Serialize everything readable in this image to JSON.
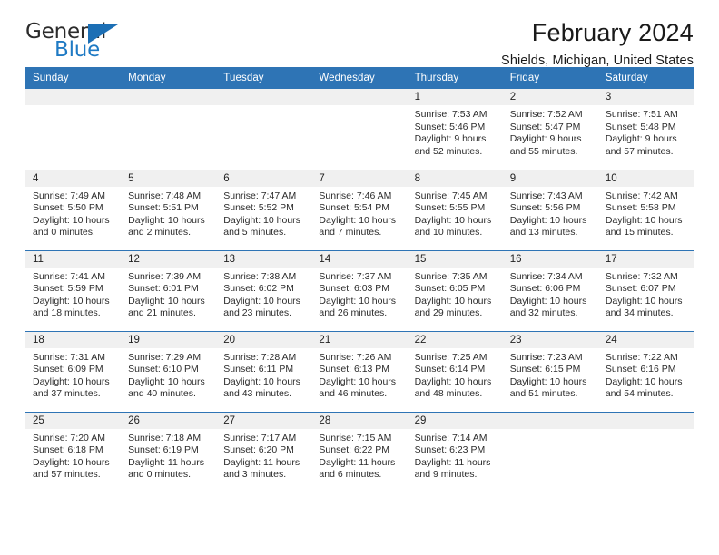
{
  "brand": {
    "name_top": "General",
    "name_bottom": "Blue",
    "accent_color": "#1c6fb5"
  },
  "header": {
    "title": "February 2024",
    "subtitle": "Shields, Michigan, United States"
  },
  "calendar": {
    "header_bg": "#2e74b5",
    "daynum_bg": "#f0f0f0",
    "weekday_headers": [
      "Sunday",
      "Monday",
      "Tuesday",
      "Wednesday",
      "Thursday",
      "Friday",
      "Saturday"
    ],
    "weeks": [
      [
        {
          "day": "",
          "sunrise": "",
          "sunset": "",
          "daylight_line1": "",
          "daylight_line2": ""
        },
        {
          "day": "",
          "sunrise": "",
          "sunset": "",
          "daylight_line1": "",
          "daylight_line2": ""
        },
        {
          "day": "",
          "sunrise": "",
          "sunset": "",
          "daylight_line1": "",
          "daylight_line2": ""
        },
        {
          "day": "",
          "sunrise": "",
          "sunset": "",
          "daylight_line1": "",
          "daylight_line2": ""
        },
        {
          "day": "1",
          "sunrise": "Sunrise: 7:53 AM",
          "sunset": "Sunset: 5:46 PM",
          "daylight_line1": "Daylight: 9 hours",
          "daylight_line2": "and 52 minutes."
        },
        {
          "day": "2",
          "sunrise": "Sunrise: 7:52 AM",
          "sunset": "Sunset: 5:47 PM",
          "daylight_line1": "Daylight: 9 hours",
          "daylight_line2": "and 55 minutes."
        },
        {
          "day": "3",
          "sunrise": "Sunrise: 7:51 AM",
          "sunset": "Sunset: 5:48 PM",
          "daylight_line1": "Daylight: 9 hours",
          "daylight_line2": "and 57 minutes."
        }
      ],
      [
        {
          "day": "4",
          "sunrise": "Sunrise: 7:49 AM",
          "sunset": "Sunset: 5:50 PM",
          "daylight_line1": "Daylight: 10 hours",
          "daylight_line2": "and 0 minutes."
        },
        {
          "day": "5",
          "sunrise": "Sunrise: 7:48 AM",
          "sunset": "Sunset: 5:51 PM",
          "daylight_line1": "Daylight: 10 hours",
          "daylight_line2": "and 2 minutes."
        },
        {
          "day": "6",
          "sunrise": "Sunrise: 7:47 AM",
          "sunset": "Sunset: 5:52 PM",
          "daylight_line1": "Daylight: 10 hours",
          "daylight_line2": "and 5 minutes."
        },
        {
          "day": "7",
          "sunrise": "Sunrise: 7:46 AM",
          "sunset": "Sunset: 5:54 PM",
          "daylight_line1": "Daylight: 10 hours",
          "daylight_line2": "and 7 minutes."
        },
        {
          "day": "8",
          "sunrise": "Sunrise: 7:45 AM",
          "sunset": "Sunset: 5:55 PM",
          "daylight_line1": "Daylight: 10 hours",
          "daylight_line2": "and 10 minutes."
        },
        {
          "day": "9",
          "sunrise": "Sunrise: 7:43 AM",
          "sunset": "Sunset: 5:56 PM",
          "daylight_line1": "Daylight: 10 hours",
          "daylight_line2": "and 13 minutes."
        },
        {
          "day": "10",
          "sunrise": "Sunrise: 7:42 AM",
          "sunset": "Sunset: 5:58 PM",
          "daylight_line1": "Daylight: 10 hours",
          "daylight_line2": "and 15 minutes."
        }
      ],
      [
        {
          "day": "11",
          "sunrise": "Sunrise: 7:41 AM",
          "sunset": "Sunset: 5:59 PM",
          "daylight_line1": "Daylight: 10 hours",
          "daylight_line2": "and 18 minutes."
        },
        {
          "day": "12",
          "sunrise": "Sunrise: 7:39 AM",
          "sunset": "Sunset: 6:01 PM",
          "daylight_line1": "Daylight: 10 hours",
          "daylight_line2": "and 21 minutes."
        },
        {
          "day": "13",
          "sunrise": "Sunrise: 7:38 AM",
          "sunset": "Sunset: 6:02 PM",
          "daylight_line1": "Daylight: 10 hours",
          "daylight_line2": "and 23 minutes."
        },
        {
          "day": "14",
          "sunrise": "Sunrise: 7:37 AM",
          "sunset": "Sunset: 6:03 PM",
          "daylight_line1": "Daylight: 10 hours",
          "daylight_line2": "and 26 minutes."
        },
        {
          "day": "15",
          "sunrise": "Sunrise: 7:35 AM",
          "sunset": "Sunset: 6:05 PM",
          "daylight_line1": "Daylight: 10 hours",
          "daylight_line2": "and 29 minutes."
        },
        {
          "day": "16",
          "sunrise": "Sunrise: 7:34 AM",
          "sunset": "Sunset: 6:06 PM",
          "daylight_line1": "Daylight: 10 hours",
          "daylight_line2": "and 32 minutes."
        },
        {
          "day": "17",
          "sunrise": "Sunrise: 7:32 AM",
          "sunset": "Sunset: 6:07 PM",
          "daylight_line1": "Daylight: 10 hours",
          "daylight_line2": "and 34 minutes."
        }
      ],
      [
        {
          "day": "18",
          "sunrise": "Sunrise: 7:31 AM",
          "sunset": "Sunset: 6:09 PM",
          "daylight_line1": "Daylight: 10 hours",
          "daylight_line2": "and 37 minutes."
        },
        {
          "day": "19",
          "sunrise": "Sunrise: 7:29 AM",
          "sunset": "Sunset: 6:10 PM",
          "daylight_line1": "Daylight: 10 hours",
          "daylight_line2": "and 40 minutes."
        },
        {
          "day": "20",
          "sunrise": "Sunrise: 7:28 AM",
          "sunset": "Sunset: 6:11 PM",
          "daylight_line1": "Daylight: 10 hours",
          "daylight_line2": "and 43 minutes."
        },
        {
          "day": "21",
          "sunrise": "Sunrise: 7:26 AM",
          "sunset": "Sunset: 6:13 PM",
          "daylight_line1": "Daylight: 10 hours",
          "daylight_line2": "and 46 minutes."
        },
        {
          "day": "22",
          "sunrise": "Sunrise: 7:25 AM",
          "sunset": "Sunset: 6:14 PM",
          "daylight_line1": "Daylight: 10 hours",
          "daylight_line2": "and 48 minutes."
        },
        {
          "day": "23",
          "sunrise": "Sunrise: 7:23 AM",
          "sunset": "Sunset: 6:15 PM",
          "daylight_line1": "Daylight: 10 hours",
          "daylight_line2": "and 51 minutes."
        },
        {
          "day": "24",
          "sunrise": "Sunrise: 7:22 AM",
          "sunset": "Sunset: 6:16 PM",
          "daylight_line1": "Daylight: 10 hours",
          "daylight_line2": "and 54 minutes."
        }
      ],
      [
        {
          "day": "25",
          "sunrise": "Sunrise: 7:20 AM",
          "sunset": "Sunset: 6:18 PM",
          "daylight_line1": "Daylight: 10 hours",
          "daylight_line2": "and 57 minutes."
        },
        {
          "day": "26",
          "sunrise": "Sunrise: 7:18 AM",
          "sunset": "Sunset: 6:19 PM",
          "daylight_line1": "Daylight: 11 hours",
          "daylight_line2": "and 0 minutes."
        },
        {
          "day": "27",
          "sunrise": "Sunrise: 7:17 AM",
          "sunset": "Sunset: 6:20 PM",
          "daylight_line1": "Daylight: 11 hours",
          "daylight_line2": "and 3 minutes."
        },
        {
          "day": "28",
          "sunrise": "Sunrise: 7:15 AM",
          "sunset": "Sunset: 6:22 PM",
          "daylight_line1": "Daylight: 11 hours",
          "daylight_line2": "and 6 minutes."
        },
        {
          "day": "29",
          "sunrise": "Sunrise: 7:14 AM",
          "sunset": "Sunset: 6:23 PM",
          "daylight_line1": "Daylight: 11 hours",
          "daylight_line2": "and 9 minutes."
        },
        {
          "day": "",
          "sunrise": "",
          "sunset": "",
          "daylight_line1": "",
          "daylight_line2": ""
        },
        {
          "day": "",
          "sunrise": "",
          "sunset": "",
          "daylight_line1": "",
          "daylight_line2": ""
        }
      ]
    ]
  }
}
